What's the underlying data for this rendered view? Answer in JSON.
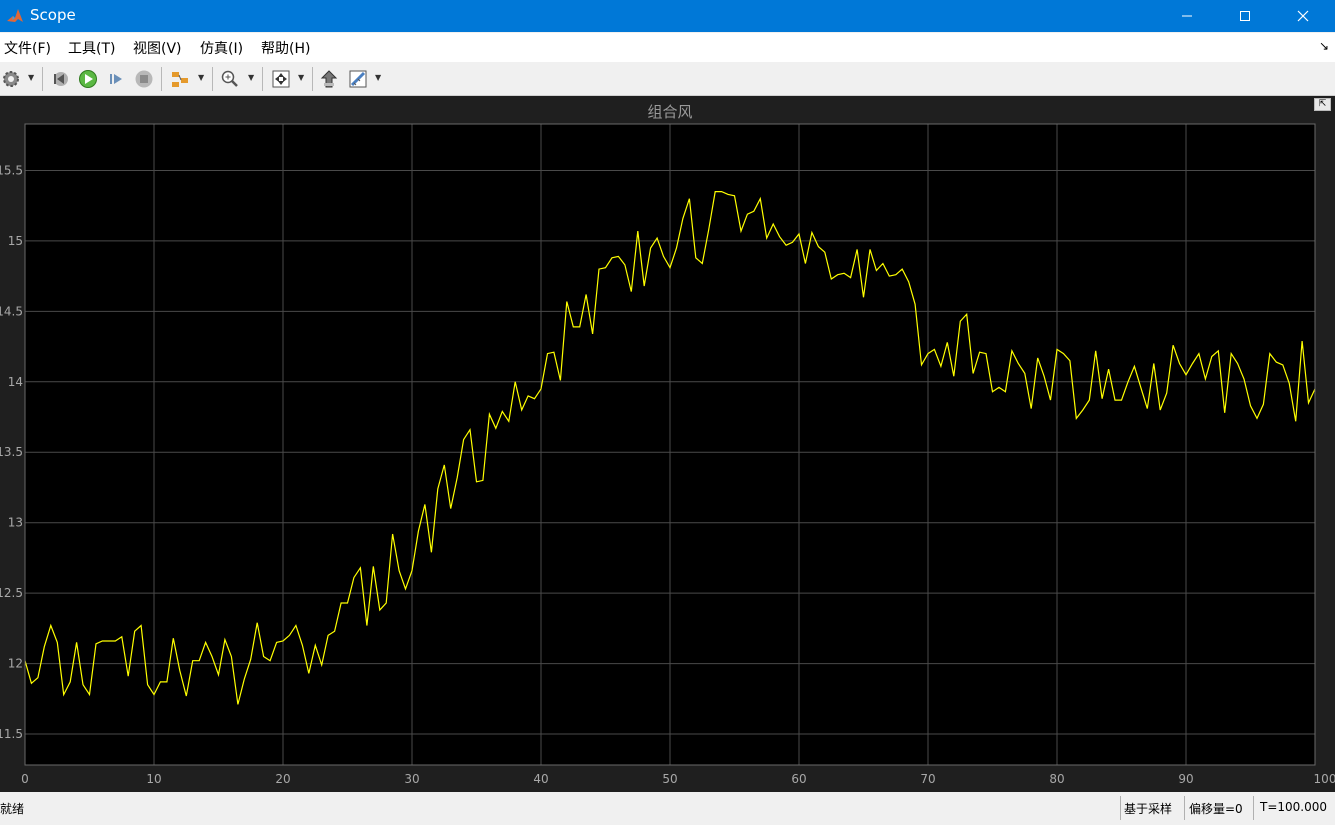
{
  "window": {
    "title": "Scope"
  },
  "menu": [
    "文件(F)",
    "工具(T)",
    "视图(V)",
    "仿真(I)",
    "帮助(H)"
  ],
  "toolbar": {
    "icons": [
      "gear-icon",
      "step-back-icon",
      "run-icon",
      "step-forward-icon",
      "stop-icon",
      "highlight-icon",
      "zoom-icon",
      "autoscale-icon",
      "simulink-icon",
      "measurement-icon"
    ]
  },
  "colors": {
    "plot_bg": "#000000",
    "axes_frame_bg": "#1f1f1f",
    "trace": "#ffff00",
    "grid": "#4a4a4a",
    "title_bar": "#0078d7"
  },
  "chart_data": {
    "type": "line",
    "title": "组合风",
    "xlim": [
      0,
      100
    ],
    "ylim": [
      11.28,
      15.83
    ],
    "xticks": [
      0,
      10,
      20,
      30,
      40,
      50,
      60,
      70,
      80,
      90,
      100
    ],
    "yticks": [
      11.5,
      12,
      12.5,
      13,
      13.5,
      14,
      14.5,
      15,
      15.5
    ],
    "ytick_labels": [
      "11.5",
      "12",
      "12.5",
      "13",
      "13.5",
      "14",
      "14.5",
      "15",
      "15.5"
    ],
    "grid": true,
    "series": [
      {
        "x": [
          0,
          0.5,
          1,
          1.5,
          2,
          2.5,
          3,
          3.5,
          4,
          4.5,
          5,
          5.5,
          6,
          6.5,
          7,
          7.5,
          8,
          8.5,
          9,
          9.5,
          10,
          10.5,
          11,
          11.5,
          12,
          12.5,
          13,
          13.5,
          14,
          14.5,
          15,
          15.5,
          16,
          16.5,
          17,
          17.5,
          18,
          18.5,
          19,
          19.5,
          20,
          20.5,
          21,
          21.5,
          22,
          22.5,
          23,
          23.5,
          24,
          24.5,
          25,
          25.5,
          26,
          26.5,
          27,
          27.5,
          28,
          28.5,
          29,
          29.5,
          30,
          30.5,
          31,
          31.5,
          32,
          32.5,
          33,
          33.5,
          34,
          34.5,
          35,
          35.5,
          36,
          36.5,
          37,
          37.5,
          38,
          38.5,
          39,
          39.5,
          40,
          40.5,
          41,
          41.5,
          42,
          42.5,
          43,
          43.5,
          44,
          44.5,
          45,
          45.5,
          46,
          46.5,
          47,
          47.5,
          48,
          48.5,
          49,
          49.5,
          50,
          50.5,
          51,
          51.5,
          52,
          52.5,
          53,
          53.5,
          54,
          54.5,
          55,
          55.5,
          56,
          56.5,
          57,
          57.5,
          58,
          58.5,
          59,
          59.5,
          60,
          60.5,
          61,
          61.5,
          62,
          62.5,
          63,
          63.5,
          64,
          64.5,
          65,
          65.5,
          66,
          66.5,
          67,
          67.5,
          68,
          68.5,
          69,
          69.5,
          70,
          70.5,
          71,
          71.5,
          72,
          72.5,
          73,
          73.5,
          74,
          74.5,
          75,
          75.5,
          76,
          76.5,
          77,
          77.5,
          78,
          78.5,
          79,
          79.5,
          80,
          80.5,
          81,
          81.5,
          82,
          82.5,
          83,
          83.5,
          84,
          84.5,
          85,
          85.5,
          86,
          86.5,
          87,
          87.5,
          88,
          88.5,
          89,
          89.5,
          90,
          90.5,
          91,
          91.5,
          92,
          92.5,
          93,
          93.5,
          94,
          94.5,
          95,
          95.5,
          96,
          96.5,
          97,
          97.5,
          98,
          98.5,
          99,
          99.5,
          100
        ],
        "y": [
          12.02,
          11.86,
          11.9,
          12.12,
          12.27,
          12.15,
          11.78,
          11.87,
          12.15,
          11.85,
          11.78,
          12.14,
          12.16,
          12.16,
          12.16,
          12.19,
          11.91,
          12.23,
          12.27,
          11.85,
          11.78,
          11.87,
          11.87,
          12.18,
          11.95,
          11.77,
          12.02,
          12.02,
          12.15,
          12.05,
          11.92,
          12.17,
          12.05,
          11.71,
          11.89,
          12.03,
          12.29,
          12.05,
          12.02,
          12.15,
          12.16,
          12.2,
          12.27,
          12.13,
          11.93,
          12.13,
          11.99,
          12.2,
          12.23,
          12.43,
          12.43,
          12.61,
          12.68,
          12.27,
          12.69,
          12.38,
          12.43,
          12.92,
          12.66,
          12.53,
          12.66,
          12.94,
          13.13,
          12.79,
          13.24,
          13.41,
          13.1,
          13.32,
          13.59,
          13.66,
          13.29,
          13.3,
          13.77,
          13.67,
          13.79,
          13.72,
          14.0,
          13.8,
          13.9,
          13.88,
          13.95,
          14.2,
          14.21,
          14.01,
          14.57,
          14.39,
          14.39,
          14.62,
          14.34,
          14.8,
          14.81,
          14.88,
          14.89,
          14.83,
          14.64,
          15.07,
          14.68,
          14.95,
          15.02,
          14.89,
          14.81,
          14.95,
          15.16,
          15.3,
          14.88,
          14.84,
          15.08,
          15.35,
          15.35,
          15.33,
          15.32,
          15.07,
          15.19,
          15.21,
          15.3,
          15.02,
          15.12,
          15.03,
          14.97,
          14.99,
          15.05,
          14.84,
          15.06,
          14.96,
          14.92,
          14.73,
          14.76,
          14.77,
          14.74,
          14.94,
          14.6,
          14.94,
          14.79,
          14.84,
          14.75,
          14.76,
          14.8,
          14.71,
          14.55,
          14.12,
          14.2,
          14.23,
          14.11,
          14.28,
          14.04,
          14.43,
          14.48,
          14.06,
          14.21,
          14.2,
          13.93,
          13.96,
          13.93,
          14.22,
          14.13,
          14.06,
          13.81,
          14.17,
          14.04,
          13.87,
          14.23,
          14.2,
          14.15,
          13.74,
          13.8,
          13.87,
          14.22,
          13.88,
          14.09,
          13.87,
          13.87,
          14.0,
          14.11,
          13.96,
          13.81,
          14.13,
          13.8,
          13.92,
          14.26,
          14.13,
          14.05,
          14.13,
          14.2,
          14.02,
          14.18,
          14.22,
          13.78,
          14.2,
          14.13,
          14.02,
          13.83,
          13.74,
          13.84,
          14.2,
          14.14,
          14.12,
          13.99,
          13.72,
          14.29,
          13.85,
          13.95
        ]
      }
    ]
  },
  "status": {
    "ready": "就绪",
    "mode": "基于采样",
    "offset": "偏移量=0",
    "time": "T=100.000"
  }
}
